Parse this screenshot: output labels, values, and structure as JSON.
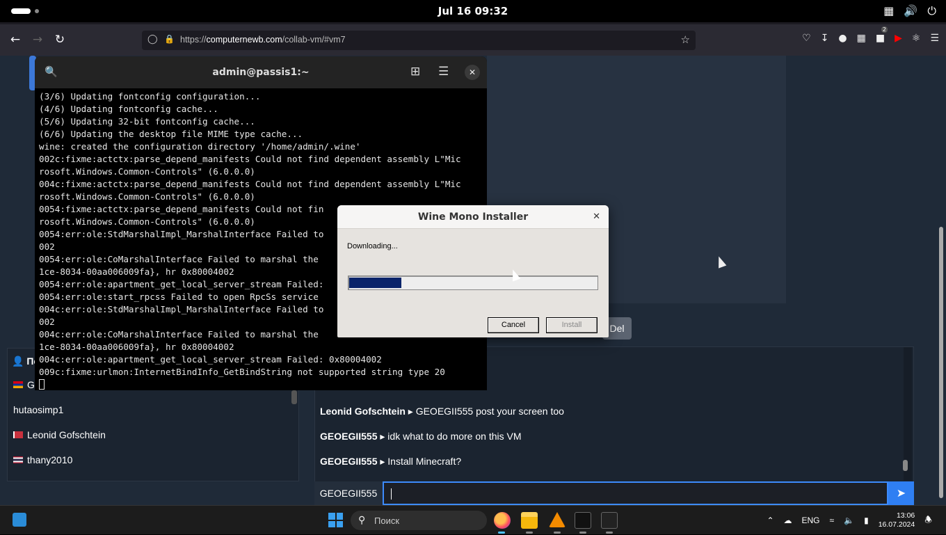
{
  "topbar": {
    "clock": "Jul 16  09:32",
    "tray_icons": [
      "network-icon",
      "volume-icon",
      "power-icon"
    ]
  },
  "browser": {
    "url_domain": "computernewb.com",
    "url_prefix": "https://",
    "url_path": "/collab-vm/#vm7",
    "extension_badge": "2"
  },
  "terminal": {
    "title": "admin@passis1:~",
    "lines": [
      "(3/6) Updating fontconfig configuration...",
      "(4/6) Updating fontconfig cache...",
      "(5/6) Updating 32-bit fontconfig cache...",
      "(6/6) Updating the desktop file MIME type cache...",
      "wine: created the configuration directory '/home/admin/.wine'",
      "002c:fixme:actctx:parse_depend_manifests Could not find dependent assembly L\"Mic",
      "rosoft.Windows.Common-Controls\" (6.0.0.0)",
      "004c:fixme:actctx:parse_depend_manifests Could not find dependent assembly L\"Mic",
      "rosoft.Windows.Common-Controls\" (6.0.0.0)",
      "0054:fixme:actctx:parse_depend_manifests Could not fin",
      "rosoft.Windows.Common-Controls\" (6.0.0.0)",
      "0054:err:ole:StdMarshalImpl_MarshalInterface Failed to",
      "002",
      "0054:err:ole:CoMarshalInterface Failed to marshal the",
      "1ce-8034-00aa006009fa}, hr 0x80004002",
      "0054:err:ole:apartment_get_local_server_stream Failed:",
      "0054:err:ole:start_rpcss Failed to open RpcSs service",
      "004c:err:ole:StdMarshalImpl_MarshalInterface Failed to",
      "002",
      "004c:err:ole:CoMarshalInterface Failed to marshal the",
      "1ce-8034-00aa006009fa}, hr 0x80004002",
      "004c:err:ole:apartment_get_local_server_stream Failed: 0x80004002",
      "009c:fixme:urlmon:InternetBindInfo_GetBindString not supported string type 20"
    ]
  },
  "wine_dialog": {
    "title": "Wine Mono Installer",
    "status": "Downloading...",
    "progress": 0.21,
    "cancel_label": "Cancel",
    "install_label": "Install"
  },
  "vm": {
    "del_label": "Del"
  },
  "users": {
    "header": "По",
    "list": [
      {
        "name": "G.",
        "flag": "am"
      },
      {
        "name": "hutaosimp1",
        "flag": ""
      },
      {
        "name": "Leonid Gofschtein",
        "flag": "by"
      },
      {
        "name": "thany2010",
        "flag": "th"
      }
    ]
  },
  "chat": {
    "messages": [
      {
        "user": "Leonid Gofschtein",
        "text": "GEOEGII555 post your screen too"
      },
      {
        "user": "GEOEGII555",
        "text": "idk what to do more on this VM"
      },
      {
        "user": "GEOEGII555",
        "text": "Install Minecraft?"
      }
    ],
    "username": "GEOEGII555",
    "input_value": ""
  },
  "taskbar": {
    "search_label": "Поиск",
    "language": "ENG",
    "time": "13:06",
    "date": "16.07.2024"
  }
}
